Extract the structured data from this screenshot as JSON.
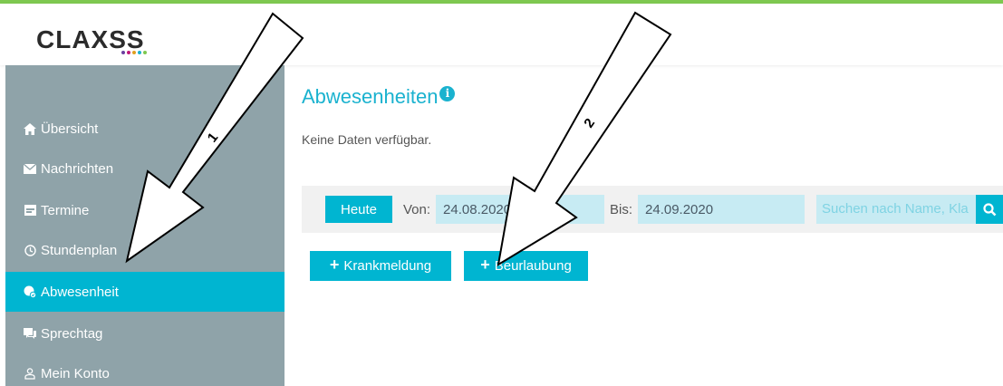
{
  "colors": {
    "accent": "#00b5d1",
    "top_bar": "#7ec850",
    "sidebar_bg": "#8fa3a9",
    "logo_dots": [
      "#6a3fa0",
      "#c2187a",
      "#e0a020",
      "#1ab2cf",
      "#7ec850"
    ]
  },
  "header": {
    "logo_text": "CLAXSS"
  },
  "sidebar": {
    "items": [
      {
        "label": "Übersicht",
        "icon": "home-icon"
      },
      {
        "label": "Nachrichten",
        "icon": "envelope-icon"
      },
      {
        "label": "Termine",
        "icon": "calendar-icon"
      },
      {
        "label": "Stundenplan",
        "icon": "clock-icon"
      },
      {
        "label": "Abwesenheit",
        "icon": "absence-icon",
        "active": true
      },
      {
        "label": "Sprechtag",
        "icon": "chat-icon"
      },
      {
        "label": "Mein Konto",
        "icon": "user-icon"
      }
    ]
  },
  "main": {
    "title": "Abwesenheiten",
    "info_icon": "i",
    "no_data": "Keine Daten verfügbar."
  },
  "filter": {
    "today_label": "Heute",
    "from_label": "Von:",
    "from_value": "24.08.2020",
    "to_label": "Bis:",
    "to_value": "24.09.2020",
    "search_placeholder": "Suchen nach Name, Kla",
    "search_icon": "search-icon"
  },
  "actions": {
    "sick_label": "Krankmeldung",
    "leave_label": "Beurlaubung"
  },
  "annotations": {
    "arrow_1_label": "1",
    "arrow_2_label": "2"
  }
}
